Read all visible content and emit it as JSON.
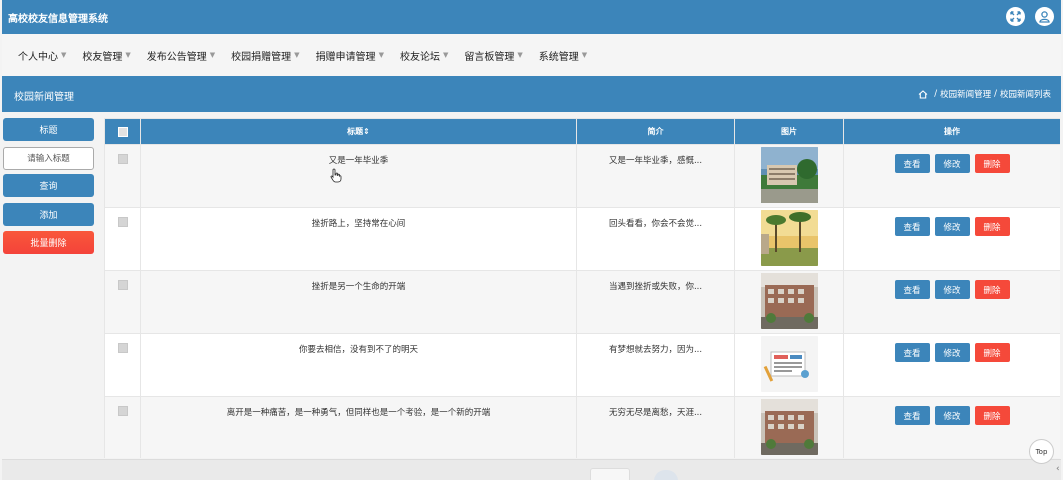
{
  "header": {
    "app_title": "高校校友信息管理系统",
    "icons": [
      "expand-icon",
      "user-icon"
    ]
  },
  "menu": {
    "items": [
      {
        "label": "个人中心"
      },
      {
        "label": "校友管理"
      },
      {
        "label": "发布公告管理"
      },
      {
        "label": "校园捐赠管理"
      },
      {
        "label": "捐赠申请管理"
      },
      {
        "label": "校友论坛"
      },
      {
        "label": "留言板管理"
      },
      {
        "label": "系统管理"
      }
    ]
  },
  "page": {
    "title": "校园新闻管理",
    "breadcrumb": [
      "校园新闻管理",
      "校园新闻列表"
    ],
    "breadcrumb_sep": "/"
  },
  "search": {
    "label": "标题",
    "placeholder": "请输入标题",
    "query_button": "查询",
    "add_button": "添加",
    "batch_delete_button": "批量删除"
  },
  "table": {
    "columns": [
      "标题",
      "简介",
      "图片",
      "操作"
    ],
    "sort_icon": "⇕",
    "rows": [
      {
        "title": "又是一年毕业季",
        "summary": "又是一年毕业季，感慨...",
        "image": "campus-building-photo"
      },
      {
        "title": "挫折路上，坚持常在心间",
        "summary": "回头看看，你会不会觉...",
        "image": "palm-trees-photo"
      },
      {
        "title": "挫折是另一个生命的开端",
        "summary": "当遇到挫折或失败，你...",
        "image": "school-building-photo"
      },
      {
        "title": "你要去相信，没有到不了的明天",
        "summary": "有梦想就去努力，因为...",
        "image": "news-illustration"
      },
      {
        "title": "离开是一种痛苦，是一种勇气，但同样也是一个考验，是一个新的开端",
        "summary": "无穷无尽是离愁，天涯...",
        "image": "school-building-photo"
      }
    ],
    "actions": {
      "view": "查看",
      "edit": "修改",
      "delete": "删除"
    }
  },
  "footer": {
    "top_button": "Top"
  },
  "colors": {
    "primary": "#3c85ba",
    "danger": "#f5493a"
  }
}
